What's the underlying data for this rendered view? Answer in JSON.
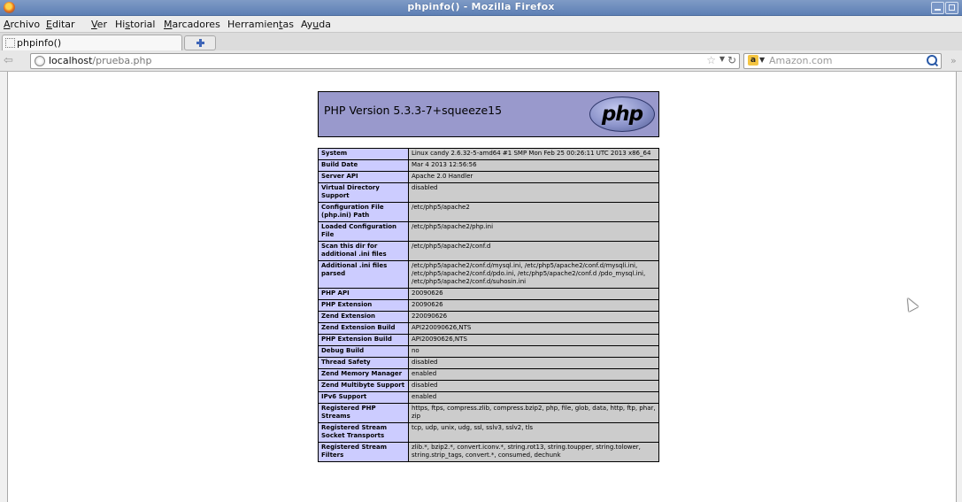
{
  "window": {
    "title": "phpinfo() - Mozilla Firefox"
  },
  "menubar": {
    "items": [
      {
        "pre": "",
        "u": "A",
        "post": "rchivo"
      },
      {
        "pre": "",
        "u": "E",
        "post": "ditar"
      },
      {
        "pre": "",
        "u": "V",
        "post": "er"
      },
      {
        "pre": "Hi",
        "u": "s",
        "post": "torial"
      },
      {
        "pre": "",
        "u": "M",
        "post": "arcadores"
      },
      {
        "pre": "Herramien",
        "u": "t",
        "post": "as"
      },
      {
        "pre": "Ay",
        "u": "u",
        "post": "da"
      }
    ]
  },
  "tabs": [
    {
      "label": "phpinfo()"
    }
  ],
  "navbar": {
    "url_host": "localhost",
    "url_path": "/prueba.php",
    "search_engine_letter": "a",
    "search_placeholder": "Amazon.com"
  },
  "page": {
    "header": {
      "version": "PHP Version 5.3.3-7+squeeze15",
      "logo": "php"
    },
    "rows": [
      {
        "key": "System",
        "value": "Linux candy 2.6.32-5-amd64 #1 SMP Mon Feb 25 00:26:11 UTC 2013 x86_64"
      },
      {
        "key": "Build Date",
        "value": "Mar 4 2013 12:56:56"
      },
      {
        "key": "Server API",
        "value": "Apache 2.0 Handler"
      },
      {
        "key": "Virtual Directory Support",
        "value": "disabled"
      },
      {
        "key": "Configuration File (php.ini) Path",
        "value": "/etc/php5/apache2"
      },
      {
        "key": "Loaded Configuration File",
        "value": "/etc/php5/apache2/php.ini"
      },
      {
        "key": "Scan this dir for additional .ini files",
        "value": "/etc/php5/apache2/conf.d"
      },
      {
        "key": "Additional .ini files parsed",
        "value": "/etc/php5/apache2/conf.d/mysql.ini, /etc/php5/apache2/conf.d/mysqli.ini, /etc/php5/apache2/conf.d/pdo.ini, /etc/php5/apache2/conf.d /pdo_mysql.ini, /etc/php5/apache2/conf.d/suhosin.ini"
      },
      {
        "key": "PHP API",
        "value": "20090626"
      },
      {
        "key": "PHP Extension",
        "value": "20090626"
      },
      {
        "key": "Zend Extension",
        "value": "220090626"
      },
      {
        "key": "Zend Extension Build",
        "value": "API220090626,NTS"
      },
      {
        "key": "PHP Extension Build",
        "value": "API20090626,NTS"
      },
      {
        "key": "Debug Build",
        "value": "no"
      },
      {
        "key": "Thread Safety",
        "value": "disabled"
      },
      {
        "key": "Zend Memory Manager",
        "value": "enabled"
      },
      {
        "key": "Zend Multibyte Support",
        "value": "disabled"
      },
      {
        "key": "IPv6 Support",
        "value": "enabled"
      },
      {
        "key": "Registered PHP Streams",
        "value": "https, ftps, compress.zlib, compress.bzip2, php, file, glob, data, http, ftp, phar, zip"
      },
      {
        "key": "Registered Stream Socket Transports",
        "value": "tcp, udp, unix, udg, ssl, sslv3, sslv2, tls"
      },
      {
        "key": "Registered Stream Filters",
        "value": "zlib.*, bzip2.*, convert.iconv.*, string.rot13, string.toupper, string.tolower, string.strip_tags, convert.*, consumed, dechunk"
      }
    ]
  }
}
